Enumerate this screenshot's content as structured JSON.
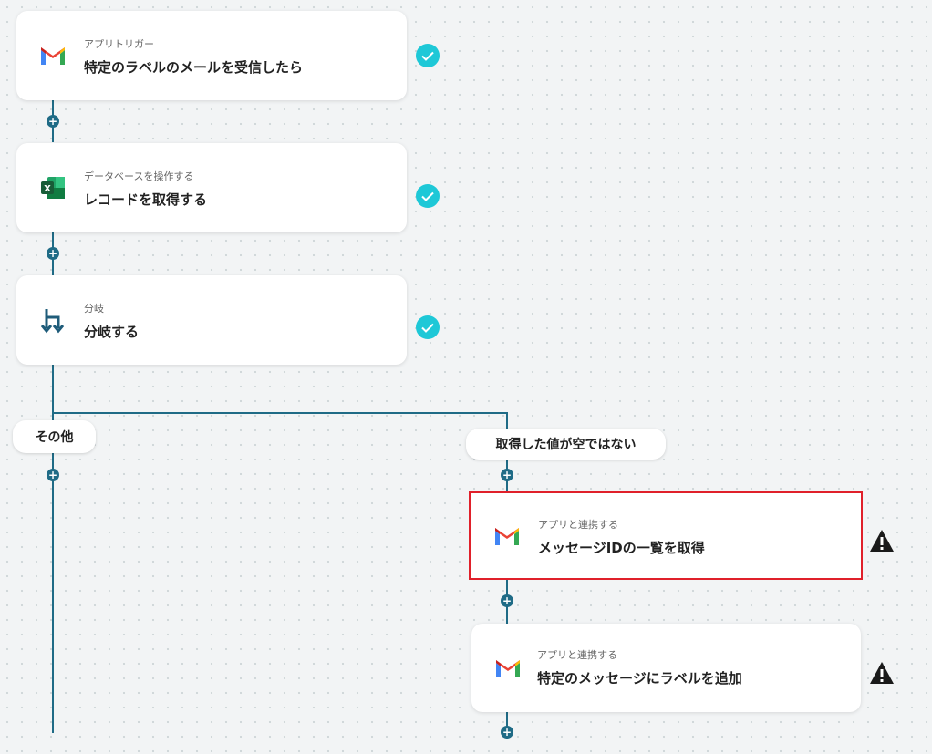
{
  "steps": [
    {
      "subtitle": "アプリトリガー",
      "title": "特定のラベルのメールを受信したら",
      "icon": "gmail-icon",
      "status": "check"
    },
    {
      "subtitle": "データベースを操作する",
      "title": "レコードを取得する",
      "icon": "excel-icon",
      "status": "check"
    },
    {
      "subtitle": "分岐",
      "title": "分岐する",
      "icon": "branch-icon",
      "status": "check"
    }
  ],
  "branches": {
    "left_label": "その他",
    "right_label": "取得した値が空ではない"
  },
  "branch_steps": [
    {
      "subtitle": "アプリと連携する",
      "title": "メッセージIDの一覧を取得",
      "icon": "gmail-icon",
      "status": "warning",
      "selected": true
    },
    {
      "subtitle": "アプリと連携する",
      "title": "特定のメッセージにラベルを追加",
      "icon": "gmail-icon",
      "status": "warning",
      "selected": false
    }
  ],
  "add_step_symbol": "+",
  "colors": {
    "connector": "#1f6b86",
    "check": "#1ec8d7",
    "selected_border": "#e0202a",
    "warning": "#1a1a1a"
  }
}
